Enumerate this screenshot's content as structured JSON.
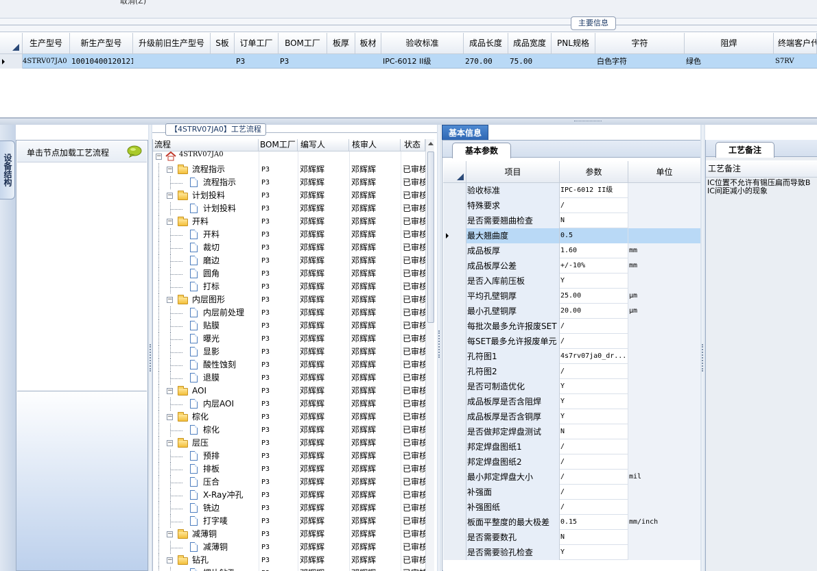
{
  "top": {
    "cancel_label": "取消(Z)",
    "main_info_tab": "主要信息"
  },
  "main_grid": {
    "columns": [
      "生产型号",
      "新生产型号",
      "升级前旧生产型号",
      "S板",
      "订单工厂",
      "BOM工厂",
      "板厚",
      "板材",
      "验收标准",
      "成品长度",
      "成品宽度",
      "PNL规格",
      "字符",
      "阻焊",
      "终端客户代"
    ],
    "row": {
      "prod_model": "4STRV07JA0",
      "new_prod_model": "10010400120121",
      "old_model": "",
      "s_board": "",
      "order_factory": "P3",
      "bom_factory": "P3",
      "thickness": "",
      "material": "",
      "acceptance": "IPC-6012 II级",
      "length": "270.00",
      "width": "75.00",
      "pnl": "",
      "char": "白色字符",
      "solder": "绿色",
      "customer": "S7RV"
    }
  },
  "side_tab": "设备结构",
  "load_panel": {
    "label": "单击节点加载工艺流程"
  },
  "flow": {
    "title": "【4STRV07JA0】工艺流程",
    "headers": {
      "flow": "流程",
      "bom": "BOM工厂",
      "author": "编写人",
      "reviewer": "核审人",
      "status": "状态"
    },
    "root": "4STRV07JA0",
    "rows": [
      {
        "level": 1,
        "type": "folder",
        "name": "流程指示",
        "bom": "P3",
        "author": "邓辉辉",
        "reviewer": "邓辉辉",
        "status": "已审核"
      },
      {
        "level": 2,
        "type": "doc",
        "name": "流程指示",
        "bom": "P3",
        "author": "邓辉辉",
        "reviewer": "邓辉辉",
        "status": "已审核"
      },
      {
        "level": 1,
        "type": "folder",
        "name": "计划投料",
        "bom": "P3",
        "author": "邓辉辉",
        "reviewer": "邓辉辉",
        "status": "已审核"
      },
      {
        "level": 2,
        "type": "doc",
        "name": "计划投料",
        "bom": "P3",
        "author": "邓辉辉",
        "reviewer": "邓辉辉",
        "status": "已审核"
      },
      {
        "level": 1,
        "type": "folder",
        "name": "开料",
        "bom": "P3",
        "author": "邓辉辉",
        "reviewer": "邓辉辉",
        "status": "已审核"
      },
      {
        "level": 2,
        "type": "doc",
        "name": "开料",
        "bom": "P3",
        "author": "邓辉辉",
        "reviewer": "邓辉辉",
        "status": "已审核"
      },
      {
        "level": 2,
        "type": "doc",
        "name": "裁切",
        "bom": "P3",
        "author": "邓辉辉",
        "reviewer": "邓辉辉",
        "status": "已审核"
      },
      {
        "level": 2,
        "type": "doc",
        "name": "磨边",
        "bom": "P3",
        "author": "邓辉辉",
        "reviewer": "邓辉辉",
        "status": "已审核"
      },
      {
        "level": 2,
        "type": "doc",
        "name": "圆角",
        "bom": "P3",
        "author": "邓辉辉",
        "reviewer": "邓辉辉",
        "status": "已审核"
      },
      {
        "level": 2,
        "type": "doc",
        "name": "打标",
        "bom": "P3",
        "author": "邓辉辉",
        "reviewer": "邓辉辉",
        "status": "已审核"
      },
      {
        "level": 1,
        "type": "folder",
        "name": "内层图形",
        "bom": "P3",
        "author": "邓辉辉",
        "reviewer": "邓辉辉",
        "status": "已审核"
      },
      {
        "level": 2,
        "type": "doc",
        "name": "内层前处理",
        "bom": "P3",
        "author": "邓辉辉",
        "reviewer": "邓辉辉",
        "status": "已审核"
      },
      {
        "level": 2,
        "type": "doc",
        "name": "贴膜",
        "bom": "P3",
        "author": "邓辉辉",
        "reviewer": "邓辉辉",
        "status": "已审核"
      },
      {
        "level": 2,
        "type": "doc",
        "name": "曝光",
        "bom": "P3",
        "author": "邓辉辉",
        "reviewer": "邓辉辉",
        "status": "已审核"
      },
      {
        "level": 2,
        "type": "doc",
        "name": "显影",
        "bom": "P3",
        "author": "邓辉辉",
        "reviewer": "邓辉辉",
        "status": "已审核"
      },
      {
        "level": 2,
        "type": "doc",
        "name": "酸性蚀刻",
        "bom": "P3",
        "author": "邓辉辉",
        "reviewer": "邓辉辉",
        "status": "已审核"
      },
      {
        "level": 2,
        "type": "doc",
        "name": "退膜",
        "bom": "P3",
        "author": "邓辉辉",
        "reviewer": "邓辉辉",
        "status": "已审核"
      },
      {
        "level": 1,
        "type": "folder",
        "name": "AOI",
        "bom": "P3",
        "author": "邓辉辉",
        "reviewer": "邓辉辉",
        "status": "已审核"
      },
      {
        "level": 2,
        "type": "doc",
        "name": "内层AOI",
        "bom": "P3",
        "author": "邓辉辉",
        "reviewer": "邓辉辉",
        "status": "已审核"
      },
      {
        "level": 1,
        "type": "folder",
        "name": "棕化",
        "bom": "P3",
        "author": "邓辉辉",
        "reviewer": "邓辉辉",
        "status": "已审核"
      },
      {
        "level": 2,
        "type": "doc",
        "name": "棕化",
        "bom": "P3",
        "author": "邓辉辉",
        "reviewer": "邓辉辉",
        "status": "已审核"
      },
      {
        "level": 1,
        "type": "folder",
        "name": "层压",
        "bom": "P3",
        "author": "邓辉辉",
        "reviewer": "邓辉辉",
        "status": "已审核"
      },
      {
        "level": 2,
        "type": "doc",
        "name": "预排",
        "bom": "P3",
        "author": "邓辉辉",
        "reviewer": "邓辉辉",
        "status": "已审核"
      },
      {
        "level": 2,
        "type": "doc",
        "name": "排板",
        "bom": "P3",
        "author": "邓辉辉",
        "reviewer": "邓辉辉",
        "status": "已审核"
      },
      {
        "level": 2,
        "type": "doc",
        "name": "压合",
        "bom": "P3",
        "author": "邓辉辉",
        "reviewer": "邓辉辉",
        "status": "已审核"
      },
      {
        "level": 2,
        "type": "doc",
        "name": "X-Ray冲孔",
        "bom": "P3",
        "author": "邓辉辉",
        "reviewer": "邓辉辉",
        "status": "已审核"
      },
      {
        "level": 2,
        "type": "doc",
        "name": "铣边",
        "bom": "P3",
        "author": "邓辉辉",
        "reviewer": "邓辉辉",
        "status": "已审核"
      },
      {
        "level": 2,
        "type": "doc",
        "name": "打字唛",
        "bom": "P3",
        "author": "邓辉辉",
        "reviewer": "邓辉辉",
        "status": "已审核"
      },
      {
        "level": 1,
        "type": "folder",
        "name": "减薄铜",
        "bom": "P3",
        "author": "邓辉辉",
        "reviewer": "邓辉辉",
        "status": "已审核"
      },
      {
        "level": 2,
        "type": "doc",
        "name": "减薄铜",
        "bom": "P3",
        "author": "邓辉辉",
        "reviewer": "邓辉辉",
        "status": "已审核"
      },
      {
        "level": 1,
        "type": "folder",
        "name": "钻孔",
        "bom": "P3",
        "author": "邓辉辉",
        "reviewer": "邓辉辉",
        "status": "已审核"
      },
      {
        "level": 2,
        "type": "doc",
        "name": "埋片钻孔",
        "bom": "P3",
        "author": "邓辉辉",
        "reviewer": "邓辉辉",
        "status": "已审核"
      }
    ]
  },
  "basic": {
    "tab": "基本信息",
    "sub_tab": "基本参数",
    "headers": {
      "item": "项目",
      "param": "参数",
      "unit": "单位"
    },
    "rows": [
      {
        "name": "验收标准",
        "value": "IPC-6012 II级",
        "unit": ""
      },
      {
        "name": "特殊要求",
        "value": "/",
        "unit": ""
      },
      {
        "name": "是否需要翘曲检查",
        "value": "N",
        "unit": ""
      },
      {
        "name": "最大翘曲度",
        "value": "0.5",
        "unit": ""
      },
      {
        "name": "成品板厚",
        "value": "1.60",
        "unit": "mm"
      },
      {
        "name": "成品板厚公差",
        "value": "+/-10%",
        "unit": "mm"
      },
      {
        "name": "是否入库前压板",
        "value": "Y",
        "unit": ""
      },
      {
        "name": "平均孔壁铜厚",
        "value": "25.00",
        "unit": "μm"
      },
      {
        "name": "最小孔壁铜厚",
        "value": "20.00",
        "unit": "μm"
      },
      {
        "name": "每批次最多允许报废SET",
        "value": "/",
        "unit": ""
      },
      {
        "name": "每SET最多允许报废单元",
        "value": "/",
        "unit": ""
      },
      {
        "name": "孔符图1",
        "value": "4s7rv07ja0_dr...",
        "unit": ""
      },
      {
        "name": "孔符图2",
        "value": "/",
        "unit": ""
      },
      {
        "name": "是否可制造优化",
        "value": "Y",
        "unit": ""
      },
      {
        "name": "成品板厚是否含阻焊",
        "value": "Y",
        "unit": ""
      },
      {
        "name": "成品板厚是否含铜厚",
        "value": "Y",
        "unit": ""
      },
      {
        "name": "是否做邦定焊盘测试",
        "value": "N",
        "unit": ""
      },
      {
        "name": "邦定焊盘图纸1",
        "value": "/",
        "unit": ""
      },
      {
        "name": "邦定焊盘图纸2",
        "value": "/",
        "unit": ""
      },
      {
        "name": "最小邦定焊盘大小",
        "value": "/",
        "unit": "mil"
      },
      {
        "name": "补强面",
        "value": "/",
        "unit": ""
      },
      {
        "name": "补强图纸",
        "value": "/",
        "unit": ""
      },
      {
        "name": "板面平整度的最大极差",
        "value": "0.15",
        "unit": "mm/inch"
      },
      {
        "name": "是否需要数孔",
        "value": "N",
        "unit": ""
      },
      {
        "name": "是否需要验孔检查",
        "value": "Y",
        "unit": ""
      }
    ]
  },
  "remark": {
    "sub_tab": "工艺备注",
    "header": "工艺备注",
    "lines": [
      "IC位置不允许有锡压扁而导致B",
      "IC间距减小的现象"
    ]
  }
}
